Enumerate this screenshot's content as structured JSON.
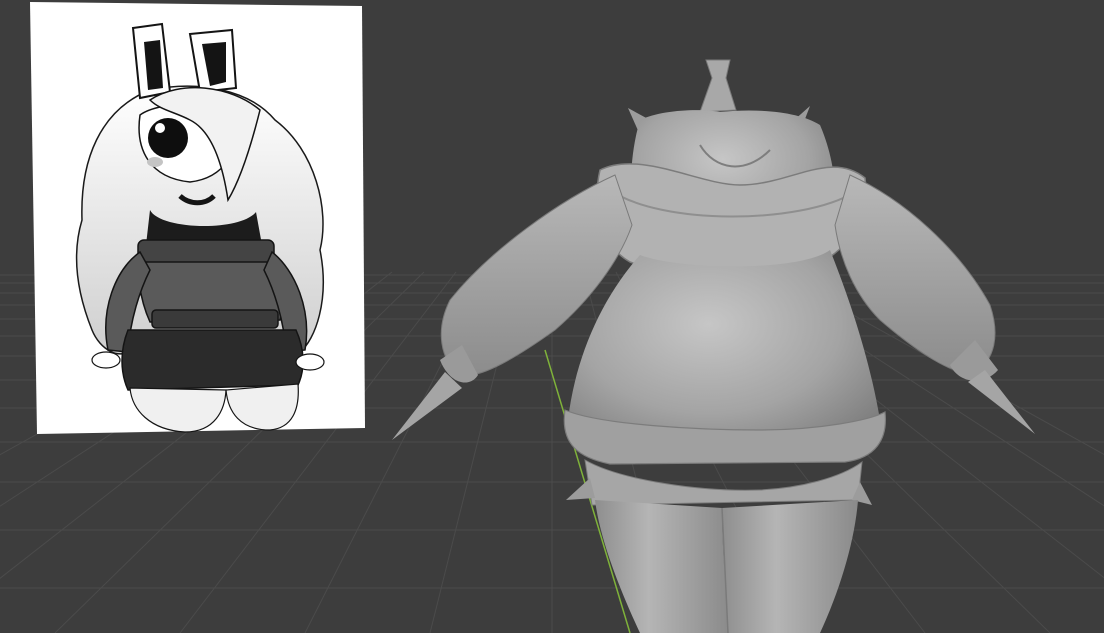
{
  "viewport": {
    "background_color": "#3d3d3d",
    "grid_color": "#4a4a4a",
    "axis_y_color": "#7fb23a",
    "mesh_base_color": "#a3a3a3",
    "mesh_highlight_color": "#c4c4c4",
    "mesh_shadow_color": "#6e6e6e"
  },
  "reference_image": {
    "icon": "reference-image-plane",
    "paper_color": "#ffffff",
    "ink_color": "#141414",
    "sweater_color": "#5a5a5a",
    "shorts_color": "#2b2b2b"
  },
  "mesh": {
    "icon": "sculpted-character-mesh",
    "shading": "solid"
  }
}
